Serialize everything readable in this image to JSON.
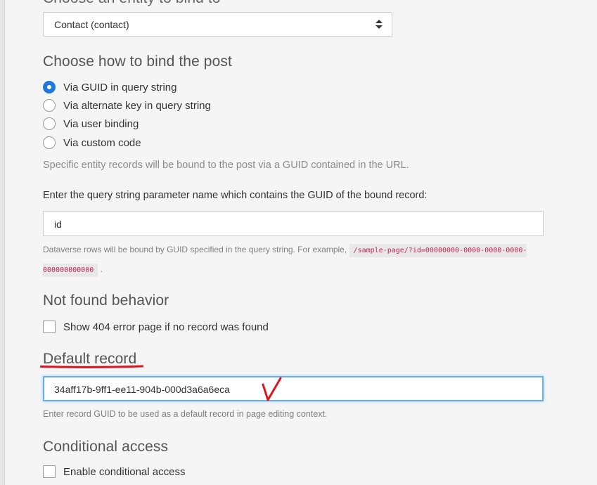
{
  "entity_section": {
    "heading": "Choose an entity to bind to",
    "selected_value": "Contact (contact)"
  },
  "bind_section": {
    "heading": "Choose how to bind the post",
    "options": [
      {
        "label": "Via GUID in query string",
        "checked": true
      },
      {
        "label": "Via alternate key in query string",
        "checked": false
      },
      {
        "label": "Via user binding",
        "checked": false
      },
      {
        "label": "Via custom code",
        "checked": false
      }
    ],
    "help": "Specific entity records will be bound to the post via a GUID contained in the URL."
  },
  "query_param": {
    "label": "Enter the query string parameter name which contains the GUID of the bound record:",
    "value": "id",
    "help_prefix": "Dataverse rows will be bound by GUID specified in the query string. For example,",
    "example_code": "/sample-page/?id=00000000-0000-0000-0000-000000000000",
    "help_suffix": "."
  },
  "not_found": {
    "heading": "Not found behavior",
    "checkbox_label": "Show 404 error page if no record was found",
    "checked": false
  },
  "default_record": {
    "heading": "Default record",
    "value": "34aff17b-9ff1-ee11-904b-000d3a6a6eca",
    "help": "Enter record GUID to be used as a default record in page editing context."
  },
  "conditional_access": {
    "heading": "Conditional access",
    "checkbox_label": "Enable conditional access",
    "checked": false
  },
  "colors": {
    "accent": "#1e78e0",
    "annotation": "#e0141e",
    "code_text": "#c7254e"
  }
}
